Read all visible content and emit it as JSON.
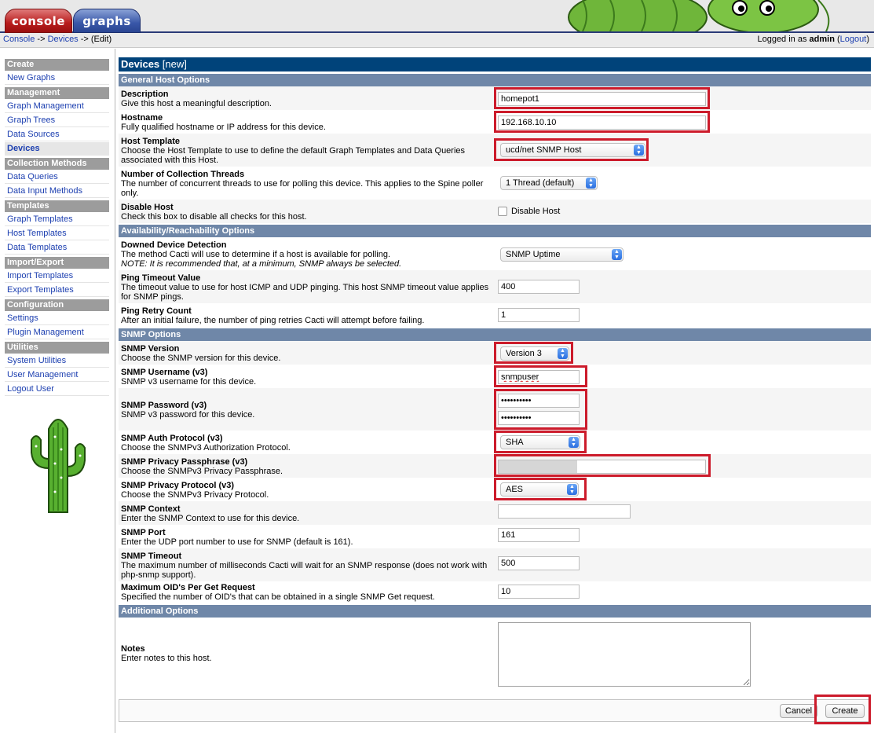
{
  "tabs": {
    "console": "console",
    "graphs": "graphs"
  },
  "breadcrumb": {
    "console": "Console",
    "sep1": " -> ",
    "devices": "Devices",
    "sep2": " -> ",
    "edit": "(Edit)"
  },
  "login": {
    "prefix": "Logged in as ",
    "user": "admin",
    "logout": "Logout",
    "open_paren": " (",
    "close_paren": ")"
  },
  "sidebar": {
    "sections": [
      {
        "head": "Create",
        "items": [
          "New Graphs"
        ]
      },
      {
        "head": "Management",
        "items": [
          "Graph Management",
          "Graph Trees",
          "Data Sources",
          "Devices"
        ]
      },
      {
        "head": "Collection Methods",
        "items": [
          "Data Queries",
          "Data Input Methods"
        ]
      },
      {
        "head": "Templates",
        "items": [
          "Graph Templates",
          "Host Templates",
          "Data Templates"
        ]
      },
      {
        "head": "Import/Export",
        "items": [
          "Import Templates",
          "Export Templates"
        ]
      },
      {
        "head": "Configuration",
        "items": [
          "Settings",
          "Plugin Management"
        ]
      },
      {
        "head": "Utilities",
        "items": [
          "System Utilities",
          "User Management",
          "Logout User"
        ]
      }
    ],
    "active_item": "Devices"
  },
  "form": {
    "title": "Devices",
    "title_suffix": "[new]",
    "sections": {
      "general": "General Host Options",
      "availability": "Availability/Reachability Options",
      "snmp": "SNMP Options",
      "additional": "Additional Options"
    },
    "fields": {
      "description": {
        "label": "Description",
        "desc": "Give this host a meaningful description.",
        "value": "homepot1"
      },
      "hostname": {
        "label": "Hostname",
        "desc": "Fully qualified hostname or IP address for this device.",
        "value": "192.168.10.10"
      },
      "host_template": {
        "label": "Host Template",
        "desc": "Choose the Host Template to use to define the default Graph Templates and Data Queries associated with this Host.",
        "value": "ucd/net SNMP Host"
      },
      "threads": {
        "label": "Number of Collection Threads",
        "desc": "The number of concurrent threads to use for polling this device. This applies to the Spine poller only.",
        "value": "1 Thread (default)"
      },
      "disable_host": {
        "label": "Disable Host",
        "desc": "Check this box to disable all checks for this host.",
        "checkbox_label": "Disable Host",
        "checked": false
      },
      "downed_detection": {
        "label": "Downed Device Detection",
        "desc": "The method Cacti will use to determine if a host is available for polling.",
        "note": "NOTE: It is recommended that, at a minimum, SNMP always be selected.",
        "value": "SNMP Uptime"
      },
      "ping_timeout": {
        "label": "Ping Timeout Value",
        "desc": "The timeout value to use for host ICMP and UDP pinging. This host SNMP timeout value applies for SNMP pings.",
        "value": "400"
      },
      "ping_retry": {
        "label": "Ping Retry Count",
        "desc": "After an initial failure, the number of ping retries Cacti will attempt before failing.",
        "value": "1"
      },
      "snmp_version": {
        "label": "SNMP Version",
        "desc": "Choose the SNMP version for this device.",
        "value": "Version 3"
      },
      "snmp_username": {
        "label": "SNMP Username (v3)",
        "desc": "SNMP v3 username for this device.",
        "value": "snmpuser"
      },
      "snmp_password": {
        "label": "SNMP Password (v3)",
        "desc": "SNMP v3 password for this device.",
        "value": "••••••••••",
        "confirm": "••••••••••"
      },
      "snmp_auth": {
        "label": "SNMP Auth Protocol (v3)",
        "desc": "Choose the SNMPv3 Authorization Protocol.",
        "value": "SHA"
      },
      "snmp_priv_pass": {
        "label": "SNMP Privacy Passphrase (v3)",
        "desc": "Choose the SNMPv3 Privacy Passphrase.",
        "value": ""
      },
      "snmp_priv_proto": {
        "label": "SNMP Privacy Protocol (v3)",
        "desc": "Choose the SNMPv3 Privacy Protocol.",
        "value": "AES"
      },
      "snmp_context": {
        "label": "SNMP Context",
        "desc": "Enter the SNMP Context to use for this device.",
        "value": ""
      },
      "snmp_port": {
        "label": "SNMP Port",
        "desc": "Enter the UDP port number to use for SNMP (default is 161).",
        "value": "161"
      },
      "snmp_timeout": {
        "label": "SNMP Timeout",
        "desc": "The maximum number of milliseconds Cacti will wait for an SNMP response (does not work with php-snmp support).",
        "value": "500"
      },
      "max_oids": {
        "label": "Maximum OID's Per Get Request",
        "desc": "Specified the number of OID's that can be obtained in a single SNMP Get request.",
        "value": "10"
      },
      "notes": {
        "label": "Notes",
        "desc": "Enter notes to this host.",
        "value": ""
      }
    },
    "buttons": {
      "cancel": "Cancel",
      "create": "Create"
    }
  },
  "colors": {
    "highlight": "#cc1b2b",
    "title_bar": "#00437a",
    "section_bar": "#6f87a8",
    "link": "#1c3fb0"
  }
}
